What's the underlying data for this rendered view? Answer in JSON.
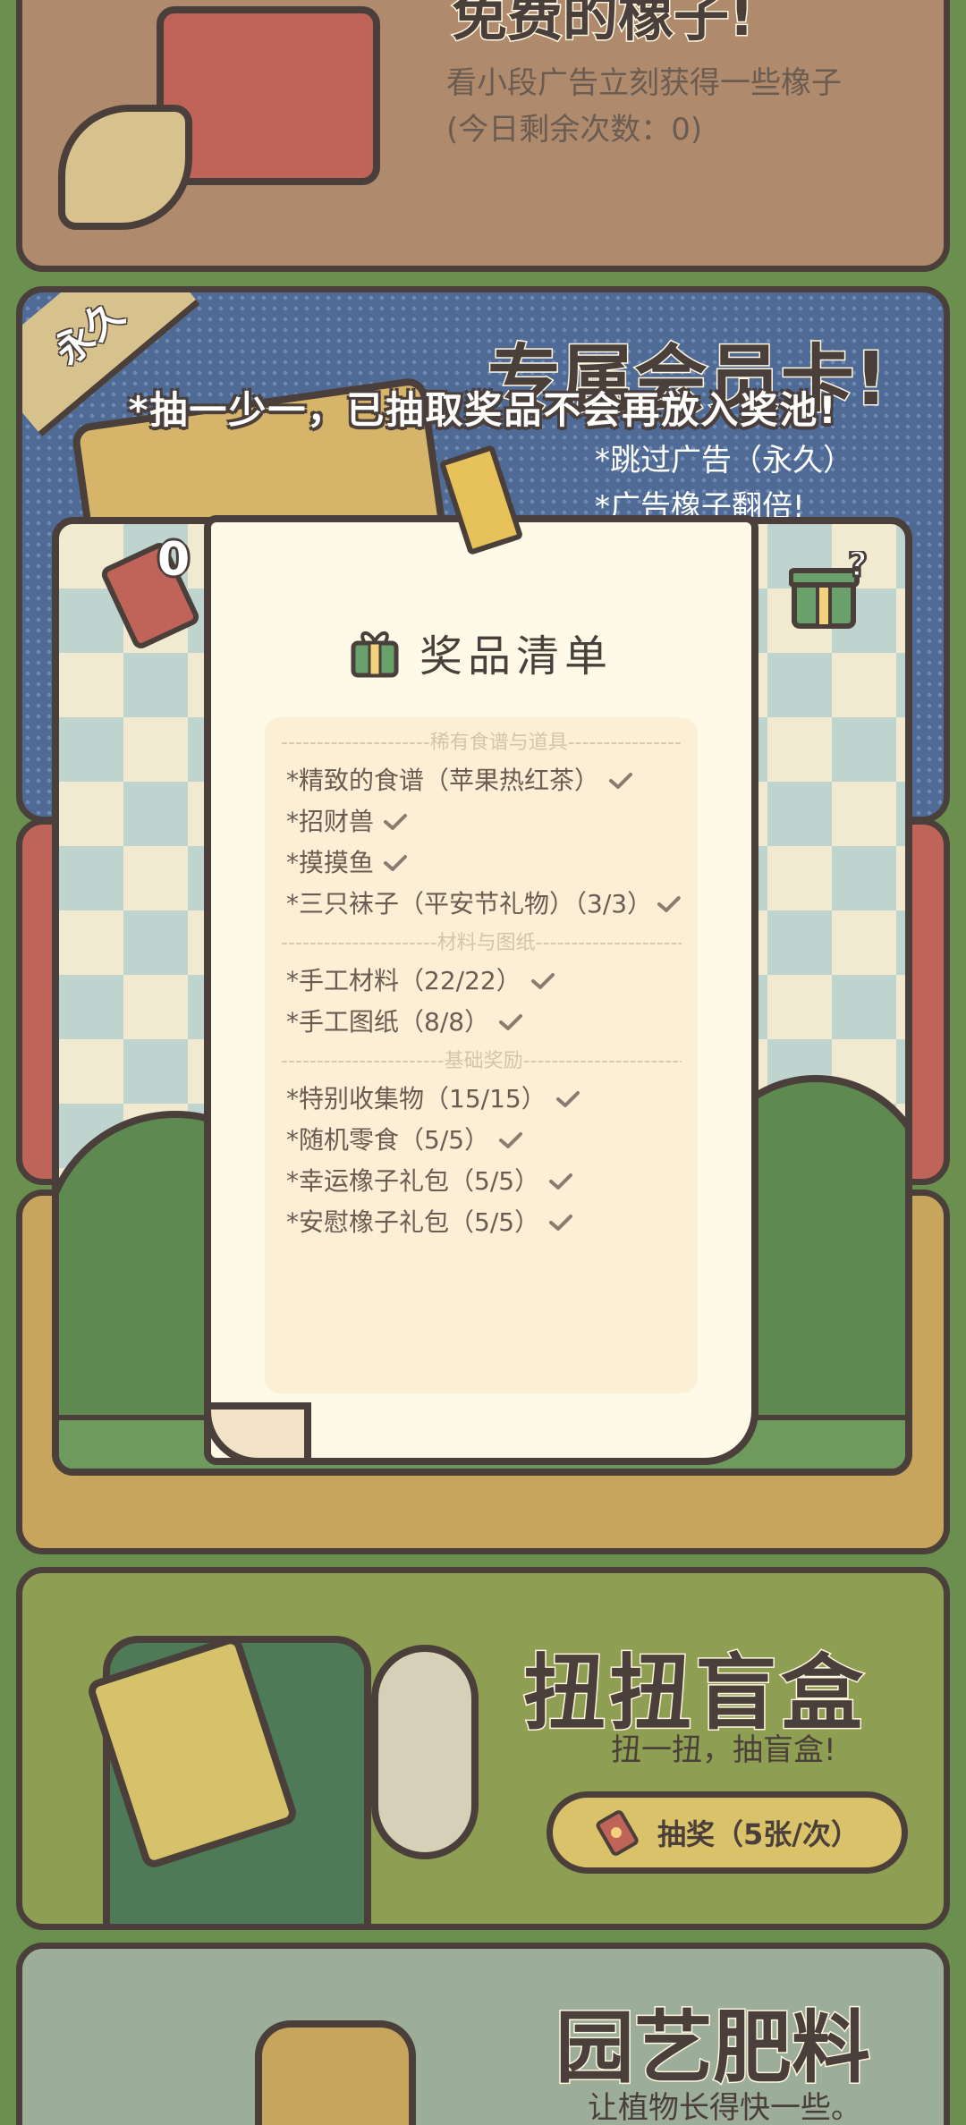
{
  "acorn_card": {
    "title": "免费的橡子!",
    "description": "看小段广告立刻获得一些橡子",
    "remaining": "(今日剩余次数：0)"
  },
  "vip_card": {
    "badge": "永久",
    "title": "专属会员卡!",
    "perk1": "*跳过广告（永久）",
    "perk2": "*广告橡子翻倍!"
  },
  "gacha_card": {
    "title": "扭扭盲盒",
    "subtitle": "扭一扭，抽盲盒!",
    "button_label": "抽奖（5张/次）"
  },
  "fertilizer_card": {
    "title": "园艺肥料",
    "subtitle": "让植物长得快一些。"
  },
  "modal": {
    "note": "*抽一少一，已抽取奖品不会再放入奖池!",
    "ticket_count": "0",
    "list_title": "奖品清单",
    "sections": [
      {
        "header": "---------------------稀有食谱与道具---------------------",
        "items": [
          "*精致的食谱（苹果热红茶）",
          "*招财兽",
          "*摸摸鱼",
          "*三只袜子（平安节礼物）（3/3）"
        ]
      },
      {
        "header": "----------------------材料与图纸----------------------",
        "items": [
          "*手工材料（22/22）",
          "*手工图纸（8/8）"
        ]
      },
      {
        "header": "-----------------------基础奖励-----------------------",
        "items": [
          "*特别收集物（15/15）",
          "*随机零食（5/5）",
          "*幸运橡子礼包（5/5）",
          "*安慰橡子礼包（5/5）"
        ]
      }
    ]
  },
  "colors": {
    "outline": "#4a3f3a",
    "paper": "#fff9e8",
    "check": "#8a7d70"
  }
}
